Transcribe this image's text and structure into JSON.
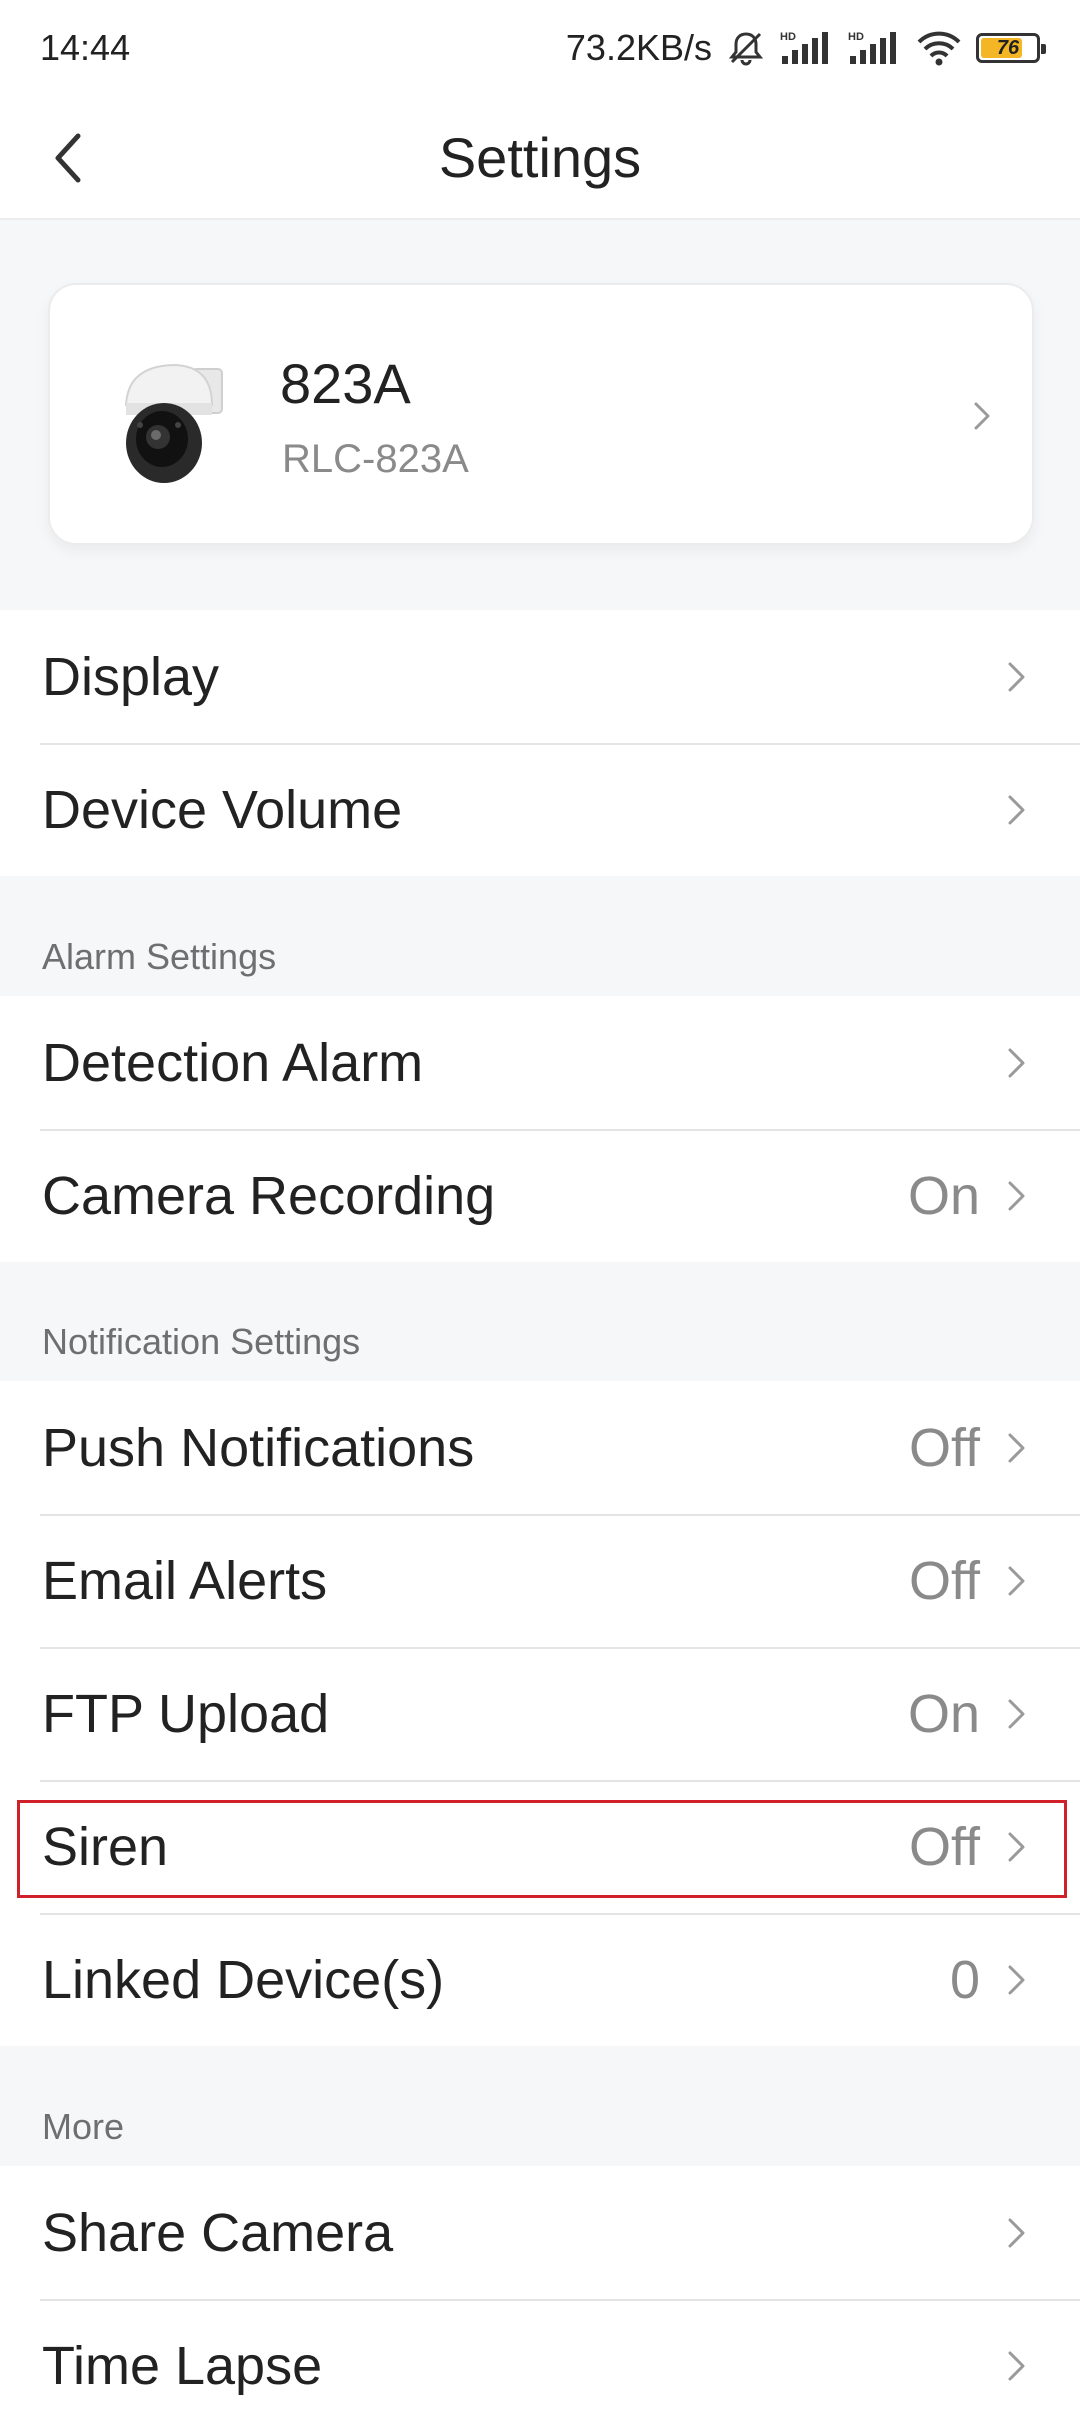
{
  "status_bar": {
    "time": "14:44",
    "network_speed": "73.2KB/s",
    "battery_level": "76",
    "battery_fraction": 0.76,
    "icons": [
      "mute-icon",
      "hd-signal-icon",
      "hd-signal-icon",
      "wifi-icon",
      "battery-icon"
    ]
  },
  "header": {
    "title": "Settings",
    "back_icon": "chevron-left-icon"
  },
  "device": {
    "name": "823A",
    "model": "RLC-823A"
  },
  "group_general": {
    "items": [
      {
        "label": "Display",
        "value": ""
      },
      {
        "label": "Device Volume",
        "value": ""
      }
    ]
  },
  "alarm_settings": {
    "header": "Alarm Settings",
    "items": [
      {
        "label": "Detection Alarm",
        "value": ""
      },
      {
        "label": "Camera Recording",
        "value": "On"
      }
    ]
  },
  "notification_settings": {
    "header": "Notification Settings",
    "items": [
      {
        "label": "Push Notifications",
        "value": "Off"
      },
      {
        "label": "Email Alerts",
        "value": "Off"
      },
      {
        "label": "FTP Upload",
        "value": "On"
      },
      {
        "label": "Siren",
        "value": "Off"
      },
      {
        "label": "Linked Device(s)",
        "value": "0"
      }
    ]
  },
  "more": {
    "header": "More",
    "items": [
      {
        "label": "Share Camera",
        "value": ""
      },
      {
        "label": "Time Lapse",
        "value": ""
      }
    ]
  },
  "colors": {
    "highlight": "#d0202a",
    "battery_fill": "#f5b626",
    "background": "#f6f7f9"
  }
}
